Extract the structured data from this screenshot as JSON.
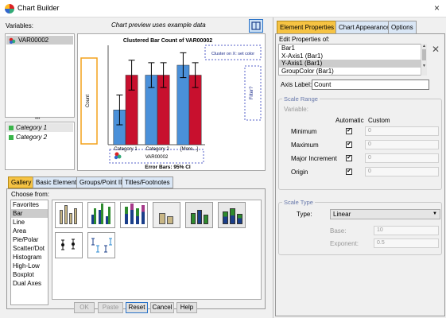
{
  "window": {
    "title": "Chart Builder",
    "close": "×"
  },
  "left": {
    "variables_label": "Variables:",
    "preview_label": "Chart preview uses example data",
    "variables": [
      "VAR00002"
    ],
    "categories": [
      "Category 1",
      "Category 2"
    ],
    "splitter": "•••"
  },
  "chart_data": {
    "type": "bar",
    "title": "Clustered Bar Count of VAR00002",
    "categories": [
      "Category 1",
      "Category 2",
      "[More...]"
    ],
    "series": [
      {
        "name": "",
        "color": "#4a90d9",
        "values": [
          14,
          28,
          32
        ]
      },
      {
        "name": "",
        "color": "#c8102e",
        "values": [
          28,
          28,
          28
        ]
      }
    ],
    "errors": [
      [
        6,
        5,
        5
      ],
      [
        6,
        5,
        5
      ]
    ],
    "ylim": [
      0,
      40
    ],
    "ylabel": "Count",
    "xlabel": "VAR00002",
    "cluster_label": "Cluster on X: set color",
    "filter_label": "Filter?",
    "footer": "Error Bars: 95% CI"
  },
  "gallery": {
    "tabs": [
      "Gallery",
      "Basic Elements",
      "Groups/Point ID",
      "Titles/Footnotes"
    ],
    "choose_from": "Choose from:",
    "types": [
      "Favorites",
      "Bar",
      "Line",
      "Area",
      "Pie/Polar",
      "Scatter/Dot",
      "Histogram",
      "High-Low",
      "Boxplot",
      "Dual Axes"
    ],
    "selected_type": "Bar"
  },
  "buttons": {
    "ok": "OK",
    "paste": "Paste",
    "reset": "Reset",
    "cancel": "Cancel",
    "help": "Help"
  },
  "right": {
    "tabs": [
      "Element Properties",
      "Chart Appearance",
      "Options"
    ],
    "edit_label": "Edit Properties of:",
    "props": [
      "Bar1",
      "X-Axis1 (Bar1)",
      "Y-Axis1 (Bar1)",
      "GroupColor (Bar1)"
    ],
    "selected_prop": "Y-Axis1 (Bar1)",
    "axis_label_caption": "Axis Label:",
    "axis_label_value": "Count",
    "scale_range": {
      "legend": "Scale Range",
      "variable": "Variable:",
      "automatic": "Automatic",
      "custom": "Custom",
      "rows": [
        {
          "label": "Minimum",
          "checked": "✔",
          "value": "0"
        },
        {
          "label": "Maximum",
          "checked": "✔",
          "value": "0"
        },
        {
          "label": "Major Increment",
          "checked": "✔",
          "value": "0"
        },
        {
          "label": "Origin",
          "checked": "✔",
          "value": "0"
        }
      ]
    },
    "scale_type": {
      "legend": "Scale Type",
      "type_label": "Type:",
      "type_value": "Linear",
      "base_label": "Base:",
      "base_value": "10",
      "exponent_label": "Exponent:",
      "exponent_value": "0.5"
    }
  }
}
